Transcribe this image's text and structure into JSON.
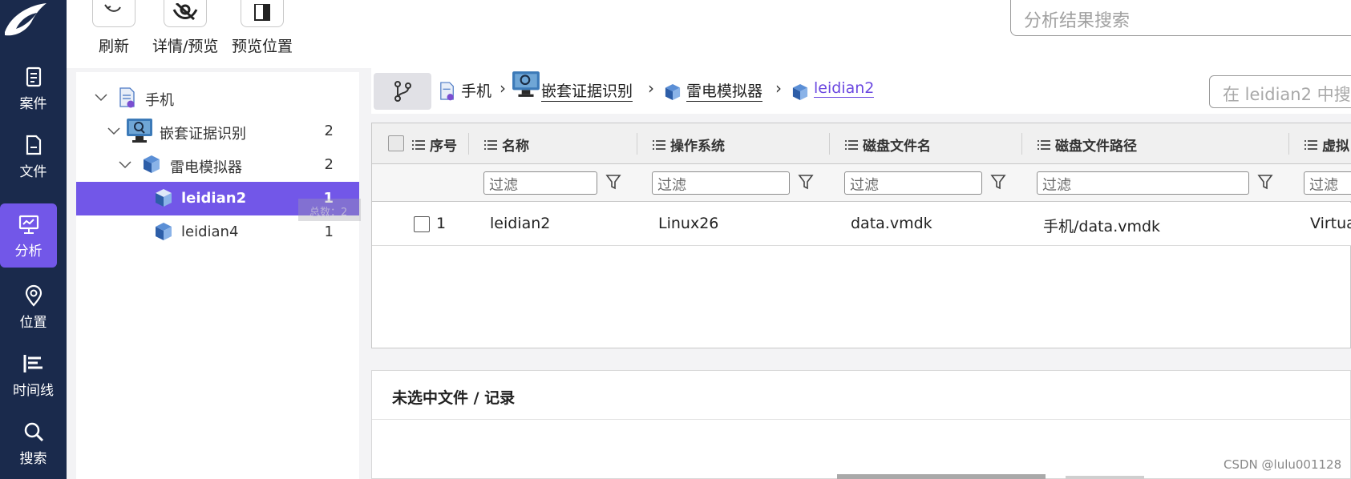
{
  "nav": {
    "items": [
      {
        "label": "案件",
        "icon": "clipboard-icon"
      },
      {
        "label": "文件",
        "icon": "file-icon"
      },
      {
        "label": "分析",
        "icon": "monitor-chart-icon",
        "active": true
      },
      {
        "label": "位置",
        "icon": "location-pin-icon"
      },
      {
        "label": "时间线",
        "icon": "timeline-icon"
      },
      {
        "label": "搜索",
        "icon": "search-icon"
      }
    ],
    "active_color": "#7257e8",
    "bg_color": "#1a2a4c"
  },
  "toolbar": {
    "refresh_label": "刷新",
    "detail_preview_label": "详情/预览",
    "preview_location_label": "预览位置",
    "search_placeholder": "分析结果搜索"
  },
  "tree": {
    "root": {
      "label": "手机"
    },
    "nodes": [
      {
        "label": "嵌套证据识别",
        "count": "2"
      },
      {
        "label": "雷电模拟器",
        "count": "2"
      },
      {
        "label": "leidian2",
        "count": "1",
        "selected": true
      },
      {
        "label": "leidian4",
        "count": "1"
      }
    ],
    "tooltip": "总数：2"
  },
  "breadcrumb": {
    "items": [
      "手机",
      "嵌套证据识别",
      "雷电模拟器",
      "leidian2"
    ],
    "search_placeholder": "在 leidian2 中搜"
  },
  "table": {
    "columns": [
      "序号",
      "名称",
      "操作系统",
      "磁盘文件名",
      "磁盘文件路径",
      "虚拟"
    ],
    "filter_placeholder": "过滤",
    "rows": [
      {
        "index": "1",
        "name": "leidian2",
        "os": "Linux26",
        "disk_file": "data.vmdk",
        "disk_path": "手机/data.vmdk",
        "virtual": "Virtua"
      }
    ]
  },
  "detail": {
    "title": "未选中文件 / 记录"
  },
  "watermark": "CSDN @lulu001128"
}
